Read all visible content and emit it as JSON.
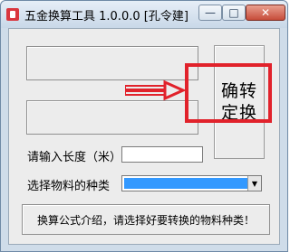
{
  "window": {
    "title": "五金换算工具 1.0.0.0 [孔令建]",
    "minimize_glyph": "—",
    "maximize_glyph": "□",
    "close_glyph": "✕"
  },
  "form": {
    "confirm_label": "确转定换",
    "length_label": "请输入长度（米）",
    "length_value": "",
    "material_label": "选择物料的种类",
    "material_selected": "",
    "info_text": "换算公式介绍，请选择好要转换的物料种类！"
  },
  "colors": {
    "highlight": "#e1222b",
    "select_highlight": "#3399ff"
  },
  "icons": {
    "app": "app-icon",
    "arrow": "red-arrow-icon",
    "dropdown": "chevron-down-icon"
  }
}
